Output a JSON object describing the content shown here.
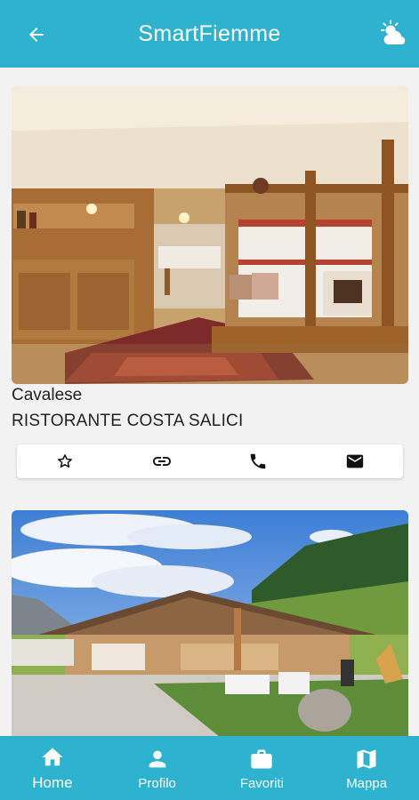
{
  "appbar": {
    "title": "SmartFiemme",
    "back_icon": "arrow-left-icon",
    "weather_icon": "partly-cloudy-icon"
  },
  "colors": {
    "primary": "#2db3cf",
    "text": "#222222"
  },
  "listings": [
    {
      "town": "Cavalese",
      "name": "RISTORANTE COSTA SALICI",
      "image": "restaurant-interior-photo",
      "actions": [
        "star-outline-icon",
        "link-icon",
        "phone-icon",
        "email-icon"
      ]
    },
    {
      "image": "alpine-restaurant-exterior-photo"
    }
  ],
  "bottom_nav": {
    "items": [
      {
        "label": "Home",
        "icon": "home-icon",
        "active": true
      },
      {
        "label": "Profilo",
        "icon": "person-icon"
      },
      {
        "label": "Favoriti",
        "icon": "briefcase-icon"
      },
      {
        "label": "Mappa",
        "icon": "map-icon"
      }
    ]
  }
}
